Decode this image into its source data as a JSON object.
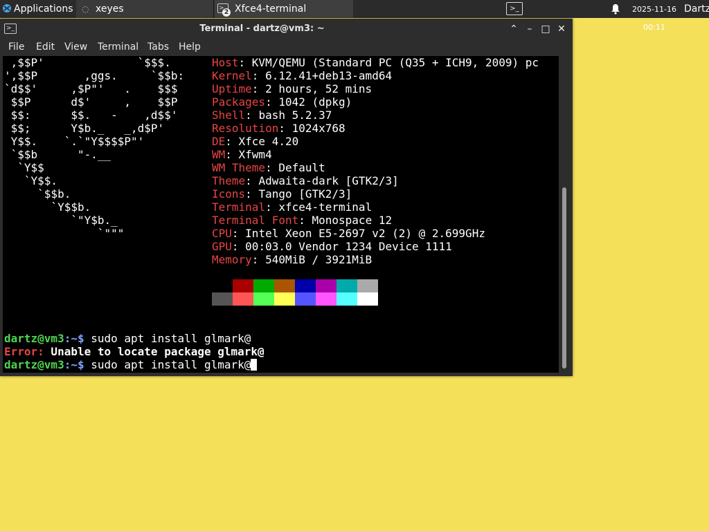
{
  "panel": {
    "applications_label": "Applications",
    "tasks": [
      {
        "label": "xeyes"
      },
      {
        "label": "Xfce4-terminal",
        "badge": "2"
      }
    ],
    "clock_date": "2025-11-16",
    "clock_time": "00:11",
    "user": "Dartz"
  },
  "window": {
    "title": "Terminal - dartz@vm3: ~",
    "menu": [
      "File",
      "Edit",
      "View",
      "Terminal",
      "Tabs",
      "Help"
    ]
  },
  "terminal": {
    "logo_lines": [
      " ,$$P'              `$$$.",
      "',$$P       ,ggs.     `$$b:",
      "`d$$'     ,$P\"'   .    $$$",
      " $$P      d$'     ,    $$P",
      " $$:      $$.   -    ,d$$'",
      " $$;      Y$b._   _,d$P'",
      " Y$$.    `.`\"Y$$$$P\"'",
      " `$$b      \"-.__",
      "  `Y$$",
      "   `Y$$.",
      "     `$$b.",
      "       `Y$$b.",
      "          `\"Y$b._",
      "              `\"\"\""
    ],
    "info": [
      {
        "key": "Host",
        "value": "KVM/QEMU (Standard PC (Q35 + ICH9, 2009) pc"
      },
      {
        "key": "Kernel",
        "value": "6.12.41+deb13-amd64"
      },
      {
        "key": "Uptime",
        "value": "2 hours, 52 mins"
      },
      {
        "key": "Packages",
        "value": "1042 (dpkg)"
      },
      {
        "key": "Shell",
        "value": "bash 5.2.37"
      },
      {
        "key": "Resolution",
        "value": "1024x768"
      },
      {
        "key": "DE",
        "value": "Xfce 4.20"
      },
      {
        "key": "WM",
        "value": "Xfwm4"
      },
      {
        "key": "WM Theme",
        "value": "Default"
      },
      {
        "key": "Theme",
        "value": "Adwaita-dark [GTK2/3]"
      },
      {
        "key": "Icons",
        "value": "Tango [GTK2/3]"
      },
      {
        "key": "Terminal",
        "value": "xfce4-terminal"
      },
      {
        "key": "Terminal Font",
        "value": "Monospace 12"
      },
      {
        "key": "CPU",
        "value": "Intel Xeon E5-2697 v2 (2) @ 2.699GHz"
      },
      {
        "key": "GPU",
        "value": "00:03.0 Vendor 1234 Device 1111"
      },
      {
        "key": "Memory",
        "value": "540MiB / 3921MiB"
      }
    ],
    "palette_row1": [
      "#000000",
      "#aa0000",
      "#00aa00",
      "#aa5500",
      "#0000aa",
      "#aa00aa",
      "#00aaaa",
      "#aaaaaa"
    ],
    "palette_row2": [
      "#555555",
      "#ff5555",
      "#55ff55",
      "#ffff55",
      "#5555ff",
      "#ff55ff",
      "#55ffff",
      "#ffffff"
    ],
    "prompt_user": "dartz@vm3",
    "prompt_path": ":~$",
    "cmd1": " sudo apt install glmark@",
    "error_label": "Error:",
    "error_msg": " Unable to locate package glmark@",
    "cmd2": " sudo apt install glmark@"
  }
}
